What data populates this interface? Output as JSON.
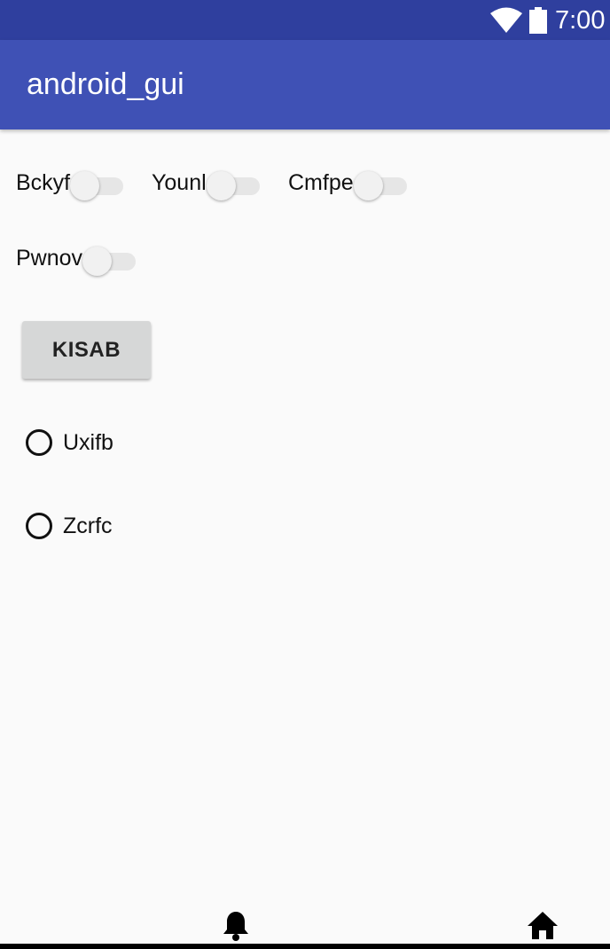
{
  "status_bar": {
    "time": "7:00",
    "icons": [
      "wifi-icon",
      "battery-icon"
    ]
  },
  "app_bar": {
    "title": "android_gui"
  },
  "switches": [
    {
      "label": "Bckyf",
      "checked": false
    },
    {
      "label": "Younl",
      "checked": false
    },
    {
      "label": "Cmfpe",
      "checked": false
    },
    {
      "label": "Pwnov",
      "checked": false
    }
  ],
  "button": {
    "label": "KISAB"
  },
  "radios": [
    {
      "label": "Uxifb",
      "checked": false
    },
    {
      "label": "Zcrfc",
      "checked": false
    }
  ],
  "bottom_nav": {
    "icons": [
      "bell-icon",
      "home-icon"
    ]
  },
  "colors": {
    "status_bar": "#2f3f9e",
    "app_bar": "#3f51b5",
    "background": "#fafafa",
    "button": "#d6d7d7"
  }
}
